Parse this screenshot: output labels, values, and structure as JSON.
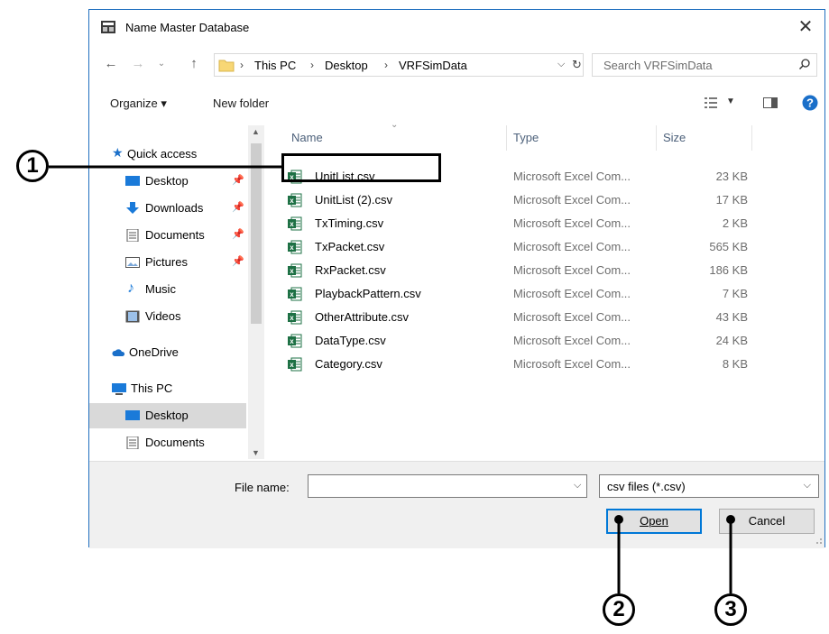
{
  "window": {
    "title": "Name Master Database"
  },
  "address": {
    "crumbs": [
      "This PC",
      "Desktop",
      "VRFSimData"
    ],
    "search_placeholder": "Search VRFSimData"
  },
  "toolbar": {
    "organize": "Organize ▾",
    "new_folder": "New folder"
  },
  "nav": {
    "items": [
      {
        "label": "Quick access"
      },
      {
        "label": "Desktop"
      },
      {
        "label": "Downloads"
      },
      {
        "label": "Documents"
      },
      {
        "label": "Pictures"
      },
      {
        "label": "Music"
      },
      {
        "label": "Videos"
      },
      {
        "label": "OneDrive"
      },
      {
        "label": "This PC"
      },
      {
        "label": "Desktop"
      },
      {
        "label": "Documents"
      }
    ]
  },
  "columns": {
    "name": "Name",
    "type": "Type",
    "size": "Size"
  },
  "files": [
    {
      "name": "UnitList.csv",
      "type": "Microsoft Excel Com...",
      "size": "23 KB"
    },
    {
      "name": "UnitList (2).csv",
      "type": "Microsoft Excel Com...",
      "size": "17 KB"
    },
    {
      "name": "TxTiming.csv",
      "type": "Microsoft Excel Com...",
      "size": "2 KB"
    },
    {
      "name": "TxPacket.csv",
      "type": "Microsoft Excel Com...",
      "size": "565 KB"
    },
    {
      "name": "RxPacket.csv",
      "type": "Microsoft Excel Com...",
      "size": "186 KB"
    },
    {
      "name": "PlaybackPattern.csv",
      "type": "Microsoft Excel Com...",
      "size": "7 KB"
    },
    {
      "name": "OtherAttribute.csv",
      "type": "Microsoft Excel Com...",
      "size": "43 KB"
    },
    {
      "name": "DataType.csv",
      "type": "Microsoft Excel Com...",
      "size": "24 KB"
    },
    {
      "name": "Category.csv",
      "type": "Microsoft Excel Com...",
      "size": "8 KB"
    }
  ],
  "bottom": {
    "file_name_label": "File name:",
    "file_name_value": "",
    "filter": "csv files (*.csv)",
    "open": "Open",
    "cancel": "Cancel"
  },
  "callouts": [
    "1",
    "2",
    "3"
  ],
  "colors": {
    "accent": "#0078d7",
    "excel_green": "#1d7044",
    "folder_yellow": "#f8d775",
    "selected": "#d9d9d9"
  }
}
